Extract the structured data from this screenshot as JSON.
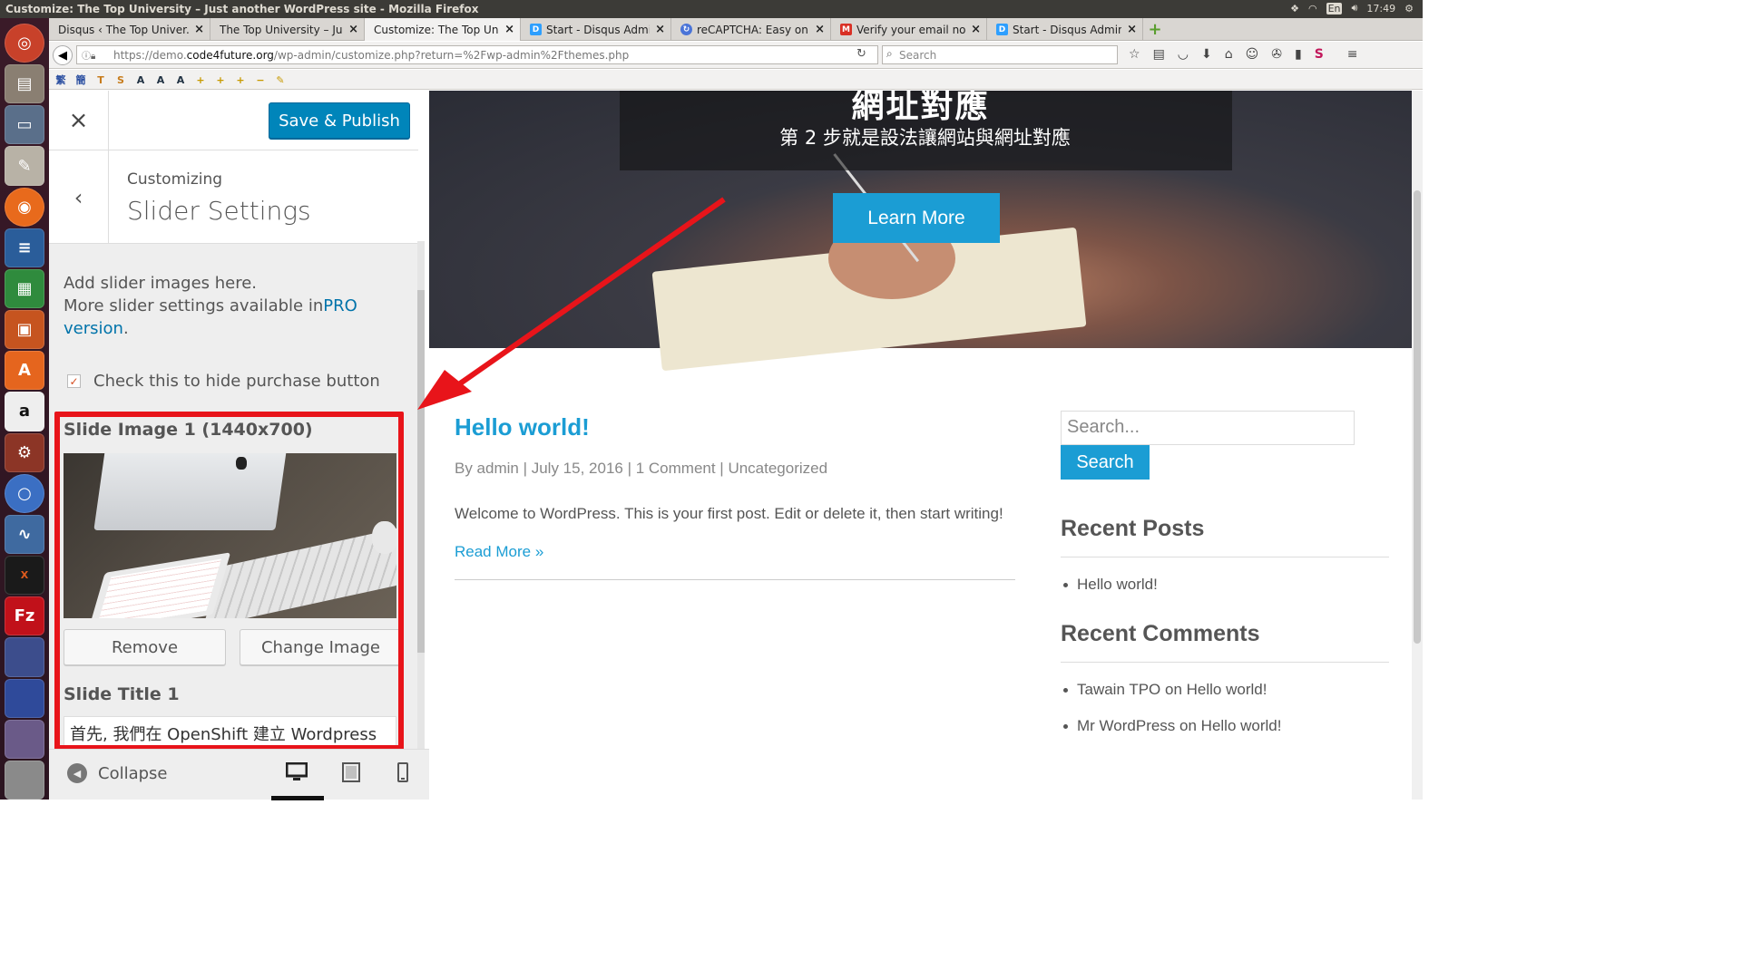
{
  "window": {
    "title": "Customize: The Top University – Just another WordPress site - Mozilla Firefox",
    "time": "17:49",
    "lang": "En"
  },
  "launcher": {
    "icons": [
      "ubuntu-icon",
      "files-icon",
      "display-icon",
      "text-editor-icon",
      "firefox-icon",
      "writer-icon",
      "calc-icon",
      "impress-icon",
      "software-center-icon",
      "amazon-icon",
      "settings-icon",
      "chromium-icon",
      "system-monitor-icon",
      "xterm-icon",
      "filezilla-icon",
      "app-icon",
      "app-icon",
      "app-icon",
      "app-icon"
    ]
  },
  "tabs": [
    {
      "label": "Disqus ‹ The Top Univer...",
      "fav": "",
      "active": false
    },
    {
      "label": "The Top University – Jus...",
      "fav": "",
      "active": false
    },
    {
      "label": "Customize: The Top Uni...",
      "fav": "",
      "active": true
    },
    {
      "label": "Start - Disqus Admin",
      "fav": "D",
      "active": false
    },
    {
      "label": "reCAPTCHA: Easy on...",
      "fav": "",
      "active": false
    },
    {
      "label": "Verify your email no...",
      "fav": "M",
      "active": false
    },
    {
      "label": "Start - Disqus Admin",
      "fav": "D",
      "active": false
    }
  ],
  "url": {
    "prefix": "https://demo.",
    "domain": "code4future.org",
    "rest": "/wp-admin/customize.php?return=%2Fwp-admin%2Fthemes.php"
  },
  "browser_search": {
    "placeholder": "Search"
  },
  "panel": {
    "close": "×",
    "save_publish": "Save & Publish",
    "back": "‹",
    "customizing": "Customizing",
    "section_title": "Slider Settings",
    "desc_line1": "Add slider images here.",
    "desc_line2": "More slider settings available in",
    "pro_link": "PRO version",
    "desc_end": ".",
    "hide_purchase_label": "Check this to hide purchase button",
    "hide_purchase_checked": true,
    "slide_image_label": "Slide Image 1 (1440x700)",
    "remove": "Remove",
    "change_image": "Change Image",
    "slide_title_label": "Slide Title 1",
    "slide_title_value": "首先, 我們在 OpenShift 建立 Wordpress",
    "collapse": "Collapse"
  },
  "preview": {
    "hero_title": "網址對應",
    "hero_subtitle": "第 2 步就是設法讓網站與網址對應",
    "learn_more": "Learn More",
    "post": {
      "title": "Hello world!",
      "meta": "By admin | July 15, 2016 | 1 Comment | Uncategorized",
      "excerpt": "Welcome to WordPress. This is your first post. Edit or delete it, then start writing!",
      "read_more": "Read More »"
    },
    "sidebar": {
      "search_placeholder": "Search...",
      "search_button": "Search",
      "recent_posts_title": "Recent Posts",
      "recent_posts": [
        "Hello world!"
      ],
      "recent_comments_title": "Recent Comments",
      "recent_comments": [
        "Tawain TPO on Hello world!",
        "Mr WordPress on Hello world!"
      ]
    }
  },
  "colors": {
    "accent": "#1b9dd4",
    "wp_blue": "#0085ba",
    "annotation_red": "#e8141a"
  }
}
